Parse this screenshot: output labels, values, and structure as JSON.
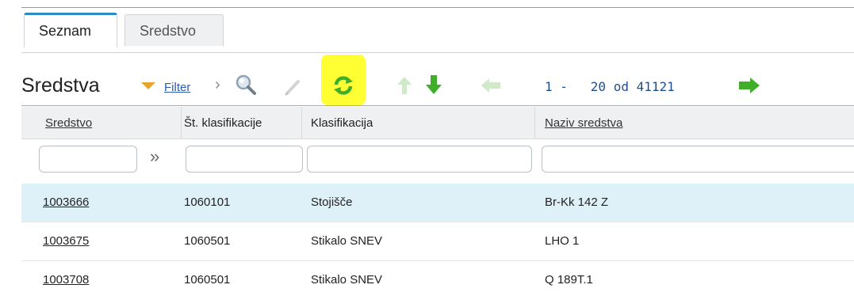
{
  "tabs": [
    {
      "label": "Seznam",
      "active": true
    },
    {
      "label": "Sredstvo",
      "active": false
    }
  ],
  "toolbar": {
    "title": "Sredstva",
    "filter_label": "Filter",
    "icons": [
      "filter-triangle-icon",
      "chevron-right-icon",
      "search-icon",
      "edit-icon",
      "refresh-icon",
      "move-up-icon",
      "move-down-icon",
      "previous-page-icon",
      "next-page-icon"
    ],
    "pager_text": "1 -   20 od 41121",
    "highlight_color": "#ffff33",
    "accent_green": "#3fae29"
  },
  "table": {
    "columns": [
      "Sredstvo",
      "Št. klasifikacije",
      "Klasifikacija",
      "Naziv sredstva"
    ],
    "expand_glyph": "»",
    "rows": [
      [
        "1003666",
        "1060101",
        "Stojišče",
        "Br-Kk 142 Z"
      ],
      [
        "1003675",
        "1060501",
        "Stikalo SNEV",
        "LHO 1"
      ],
      [
        "1003708",
        "1060501",
        "Stikalo SNEV",
        "Q 189T.1"
      ]
    ]
  }
}
